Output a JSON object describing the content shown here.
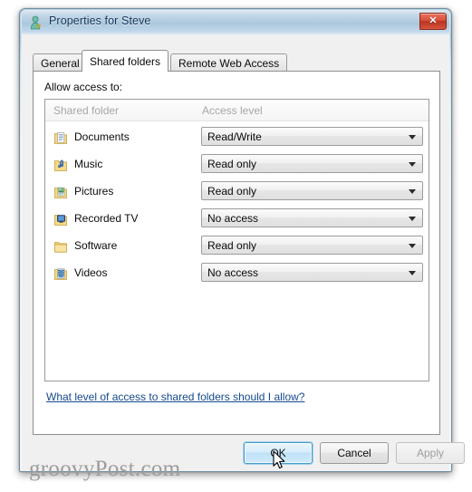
{
  "window": {
    "title": "Properties for Steve",
    "title_icon": "user-icon",
    "close_label": "✕"
  },
  "tabs": [
    {
      "label": "General",
      "active": false
    },
    {
      "label": "Shared folders",
      "active": true
    },
    {
      "label": "Remote Web Access",
      "active": false
    }
  ],
  "panel": {
    "allow_access_label": "Allow access to:",
    "columns": {
      "shared_folder": "Shared folder",
      "access_level": "Access level"
    },
    "rows": [
      {
        "name": "Documents",
        "icon": "documents-folder-icon",
        "access": "Read/Write"
      },
      {
        "name": "Music",
        "icon": "music-folder-icon",
        "access": "Read only"
      },
      {
        "name": "Pictures",
        "icon": "pictures-folder-icon",
        "access": "Read only"
      },
      {
        "name": "Recorded TV",
        "icon": "recorded-tv-folder-icon",
        "access": "No access"
      },
      {
        "name": "Software",
        "icon": "software-folder-icon",
        "access": "Read only"
      },
      {
        "name": "Videos",
        "icon": "videos-folder-icon",
        "access": "No access"
      }
    ],
    "access_options": [
      "Read/Write",
      "Read only",
      "No access"
    ],
    "help_link": "What level of access to shared folders should I allow?"
  },
  "buttons": {
    "ok": "OK",
    "cancel": "Cancel",
    "apply": "Apply"
  },
  "watermark": "groovyPost.com",
  "colors": {
    "title_bar_blue": "#b0cade",
    "close_red": "#d9503c",
    "link_blue": "#15498c",
    "default_button_border": "#4a9cc9",
    "disabled_text": "#9e9e9e"
  }
}
